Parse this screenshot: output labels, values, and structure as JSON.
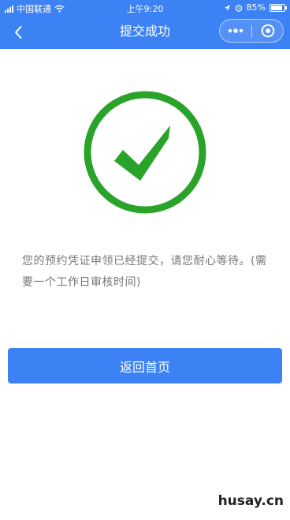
{
  "status_bar": {
    "carrier": "中国联通",
    "time": "上午9:20",
    "battery": "85%",
    "battery_level": 0.85
  },
  "nav": {
    "title": "提交成功",
    "back_icon": "chevron-left-icon",
    "more_icon": "more-dots-icon",
    "close_icon": "close-target-icon"
  },
  "success": {
    "icon": "checkmark-circle-icon",
    "color": "#2aa32a"
  },
  "message": {
    "text": "您的预约凭证申领已经提交，请您耐心等待。(需要一个工作日审核时间)"
  },
  "actions": {
    "return_label": "返回首页"
  },
  "watermark": "husay.cn",
  "colors": {
    "primary": "#3c82f5",
    "text_muted": "#777777"
  }
}
